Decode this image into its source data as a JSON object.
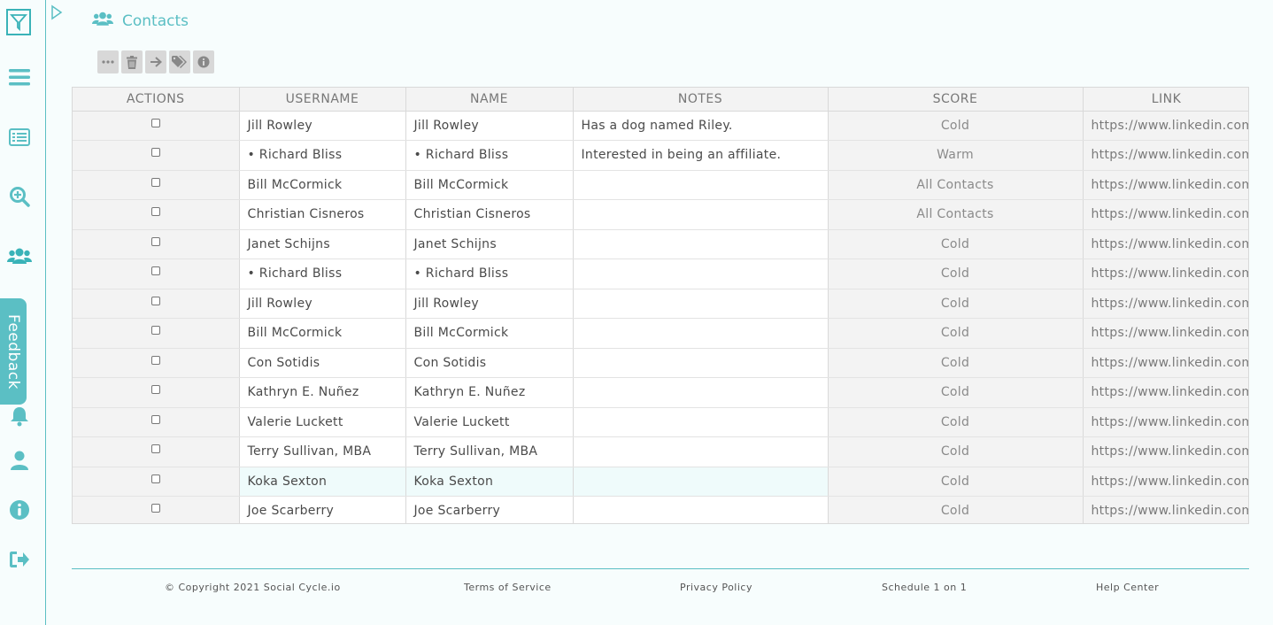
{
  "page": {
    "title": "Contacts"
  },
  "sidebar": {
    "feedback_label": "Feedback",
    "icons": [
      "filter-logo-icon",
      "menu-icon",
      "list-icon",
      "search-zoom-icon",
      "contacts-icon",
      "bell-icon",
      "user-icon",
      "info-icon",
      "logout-icon"
    ]
  },
  "toolbar": {
    "buttons": [
      "more-icon",
      "trash-icon",
      "arrow-right-icon",
      "tags-icon",
      "info-icon"
    ]
  },
  "table": {
    "headers": [
      "ACTIONS",
      "USERNAME",
      "NAME",
      "NOTES",
      "SCORE",
      "LINK"
    ],
    "rows": [
      {
        "username": "Jill Rowley",
        "name": "Jill Rowley",
        "notes": "Has a dog named Riley.",
        "score": "Cold",
        "link": "https://www.linkedin.com"
      },
      {
        "username": "• Richard Bliss",
        "name": "• Richard Bliss",
        "notes": "Interested in being an affiliate.",
        "score": "Warm",
        "link": "https://www.linkedin.com"
      },
      {
        "username": "Bill McCormick",
        "name": "Bill McCormick",
        "notes": "",
        "score": "All Contacts",
        "link": "https://www.linkedin.com"
      },
      {
        "username": "Christian Cisneros",
        "name": "Christian Cisneros",
        "notes": "",
        "score": "All Contacts",
        "link": "https://www.linkedin.com"
      },
      {
        "username": "Janet Schijns",
        "name": "Janet Schijns",
        "notes": "",
        "score": "Cold",
        "link": "https://www.linkedin.com"
      },
      {
        "username": "• Richard Bliss",
        "name": "• Richard Bliss",
        "notes": "",
        "score": "Cold",
        "link": "https://www.linkedin.com"
      },
      {
        "username": "Jill Rowley",
        "name": "Jill Rowley",
        "notes": "",
        "score": "Cold",
        "link": "https://www.linkedin.com"
      },
      {
        "username": "Bill McCormick",
        "name": "Bill McCormick",
        "notes": "",
        "score": "Cold",
        "link": "https://www.linkedin.com"
      },
      {
        "username": "Con Sotidis",
        "name": "Con Sotidis",
        "notes": "",
        "score": "Cold",
        "link": "https://www.linkedin.com"
      },
      {
        "username": "Kathryn E. Nuñez",
        "name": "Kathryn E. Nuñez",
        "notes": "",
        "score": "Cold",
        "link": "https://www.linkedin.com"
      },
      {
        "username": "Valerie Luckett",
        "name": "Valerie Luckett",
        "notes": "",
        "score": "Cold",
        "link": "https://www.linkedin.com"
      },
      {
        "username": "Terry Sullivan, MBA",
        "name": "Terry Sullivan, MBA",
        "notes": "",
        "score": "Cold",
        "link": "https://www.linkedin.com"
      },
      {
        "username": "Koka Sexton",
        "name": "Koka Sexton",
        "notes": "",
        "score": "Cold",
        "link": "https://www.linkedin.com"
      },
      {
        "username": "Joe Scarberry",
        "name": "Joe Scarberry",
        "notes": "",
        "score": "Cold",
        "link": "https://www.linkedin.com"
      }
    ]
  },
  "footer": {
    "copyright": "© Copyright 2021 Social Cycle.io",
    "terms": "Terms of Service",
    "privacy": "Privacy Policy",
    "schedule": "Schedule 1 on 1",
    "help": "Help Center"
  },
  "colors": {
    "accent": "#5bbfc4",
    "header_bg": "#f3f3f3",
    "highlight_row": "#effbfb"
  }
}
